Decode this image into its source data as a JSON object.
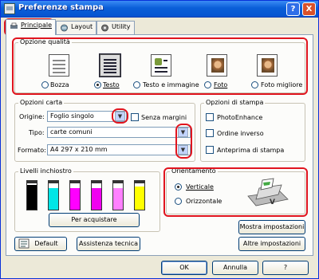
{
  "window": {
    "title": "Preferenze stampa",
    "help": "?",
    "close": "X"
  },
  "tabs": [
    {
      "label": "Principale",
      "icon": "printer-icon"
    },
    {
      "label": "Layout",
      "icon": "layout-icon"
    },
    {
      "label": "Utility",
      "icon": "utility-icon"
    }
  ],
  "quality": {
    "legend": "Opzione qualità",
    "options": [
      {
        "label": "Bozza",
        "icon": "draft-document-icon",
        "selected": false
      },
      {
        "label": "Testo",
        "icon": "text-document-icon",
        "selected": true
      },
      {
        "label": "Testo e immagine",
        "icon": "text-image-document-icon",
        "selected": false
      },
      {
        "label": "Foto",
        "icon": "photo-icon",
        "selected": false
      },
      {
        "label": "Foto migliore",
        "icon": "best-photo-icon",
        "selected": false
      }
    ]
  },
  "paper": {
    "legend": "Opzioni carta",
    "source_label": "Origine:",
    "source_value": "Foglio singolo",
    "borderless_label": "Senza margini",
    "type_label": "Tipo:",
    "type_value": "carte comuni",
    "size_label": "Formato:",
    "size_value": "A4 297 x 210 mm"
  },
  "print_options": {
    "legend": "Opzioni di stampa",
    "items": [
      "PhotoEnhance",
      "Ordine inverso",
      "Anteprima di stampa"
    ]
  },
  "ink": {
    "legend": "Livelli inchiostro",
    "cartridges": [
      {
        "color": "#000000",
        "level": 0.85
      },
      {
        "color": "#00e6e6",
        "level": 0.75
      },
      {
        "color": "#ff00ff",
        "level": 0.75
      },
      {
        "color": "#f000f0",
        "level": 0.75
      },
      {
        "color": "#ff80ff",
        "level": 0.75
      },
      {
        "color": "#ffff00",
        "level": 0.8
      }
    ],
    "buy_label": "Per acquistare"
  },
  "orientation": {
    "legend": "Orientamento",
    "portrait_label": "Verticale",
    "portrait_selected": true,
    "landscape_label": "Orizzontale"
  },
  "buttons": {
    "default": "Default",
    "support": "Assistenza tecnica",
    "show_settings": "Mostra impostazioni",
    "other_settings": "Altre impostazioni",
    "ok": "OK",
    "cancel": "Annulla",
    "help": "?"
  },
  "colors": {
    "highlight": "#e0141e",
    "title_bar": "#0a5fd8"
  }
}
